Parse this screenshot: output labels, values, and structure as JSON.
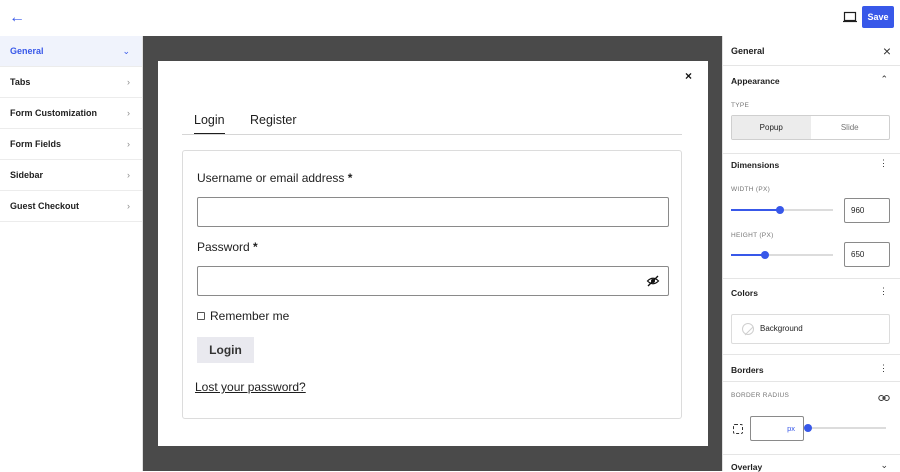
{
  "topbar": {
    "back_icon": "arrow-left-icon",
    "device_icon": "desktop-icon",
    "save_label": "Save"
  },
  "colors": {
    "accent": "#3858e9",
    "canvas": "#4a4a4a"
  },
  "sidebar": {
    "items": [
      {
        "label": "General",
        "active": true
      },
      {
        "label": "Tabs"
      },
      {
        "label": "Form Customization"
      },
      {
        "label": "Form Fields"
      },
      {
        "label": "Sidebar"
      },
      {
        "label": "Guest Checkout"
      }
    ],
    "chev_down": "⌄",
    "chev_right": "›"
  },
  "preview": {
    "close": "×",
    "tabs": [
      "Login",
      "Register"
    ],
    "username_label": "Username or email address",
    "password_label": "Password",
    "required_mark": "*",
    "username_value": "",
    "password_value": "",
    "remember_label": "Remember me",
    "login_button": "Login",
    "lost_link": "Lost your password?"
  },
  "panel": {
    "title": "General",
    "close": "×",
    "appearance": {
      "title": "Appearance",
      "type_caption": "TYPE",
      "options": [
        "Popup",
        "Slide"
      ],
      "selected": "Popup"
    },
    "dimensions": {
      "title": "Dimensions",
      "width_caption": "WIDTH (PX)",
      "width_value": "960",
      "width_fraction": 0.48,
      "height_caption": "HEIGHT (PX)",
      "height_value": "650",
      "height_fraction": 0.33
    },
    "colors": {
      "title": "Colors",
      "background_label": "Background"
    },
    "borders": {
      "title": "Borders",
      "radius_caption": "BORDER RADIUS",
      "radius_unit": "px",
      "radius_fraction": 0.0
    },
    "overlay": {
      "title": "Overlay"
    },
    "menu_icon": "⋮",
    "expand_icon": "⌃",
    "collapse_icon": "⌄"
  }
}
